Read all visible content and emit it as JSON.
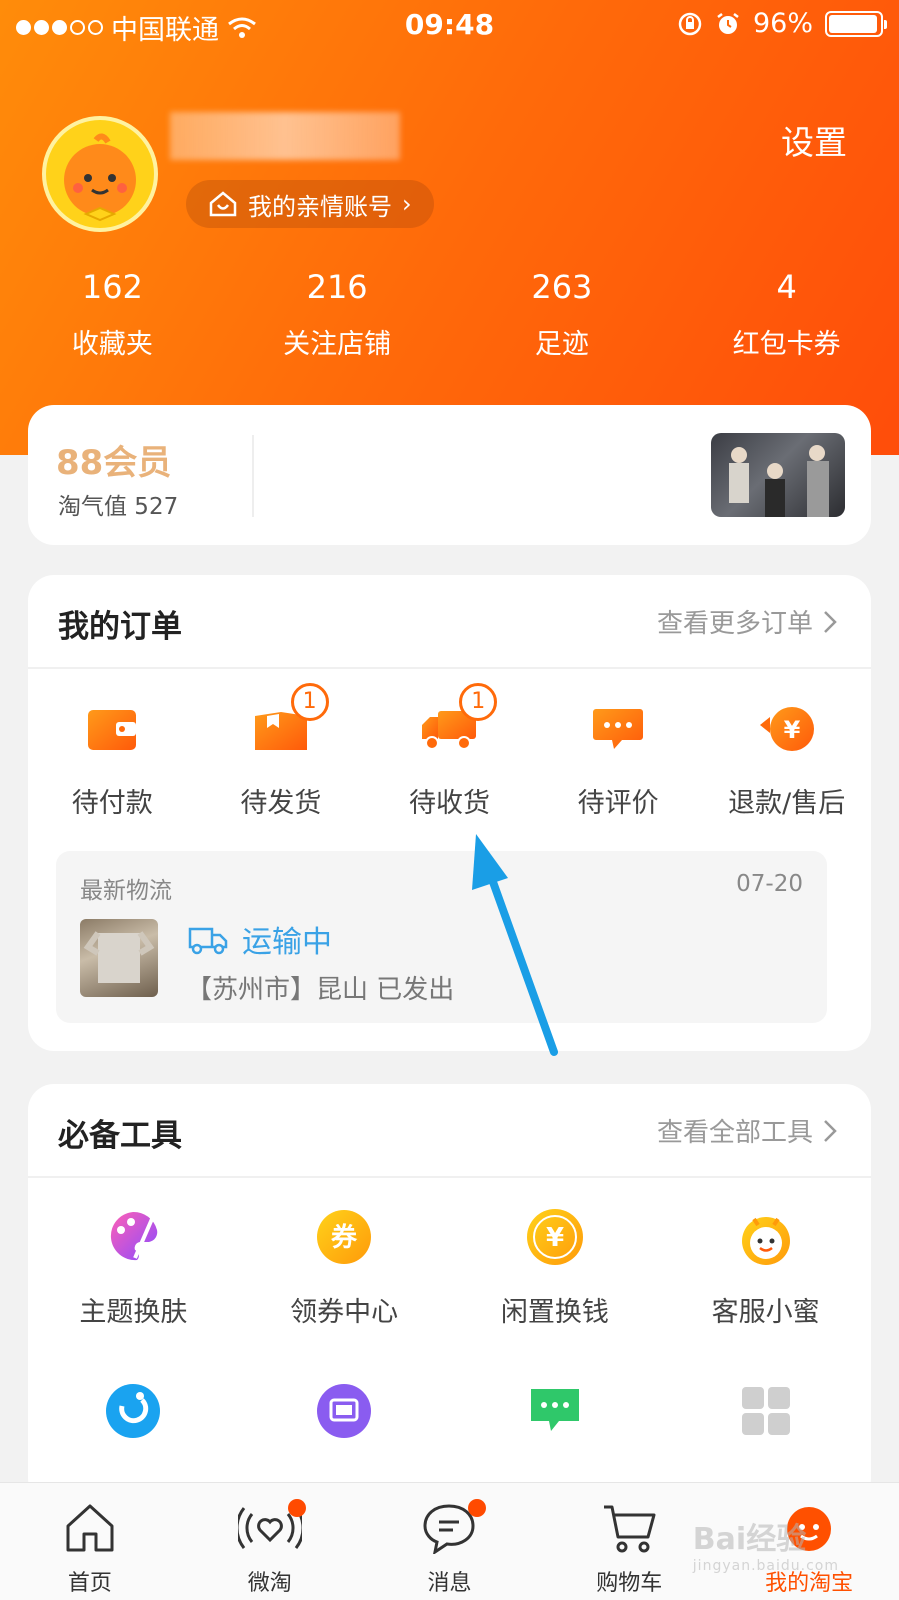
{
  "status_bar": {
    "carrier": "中国联通",
    "time": "09:48",
    "battery": "96%",
    "battery_level": 0.96
  },
  "profile": {
    "family_account": "我的亲情账号",
    "settings": "设置"
  },
  "stats": [
    {
      "count": "162",
      "label": "收藏夹"
    },
    {
      "count": "216",
      "label": "关注店铺"
    },
    {
      "count": "263",
      "label": "足迹"
    },
    {
      "count": "4",
      "label": "红包卡券"
    }
  ],
  "vip": {
    "title": "88会员",
    "score": "淘气值 527"
  },
  "orders": {
    "title": "我的订单",
    "more": "查看更多订单",
    "items": [
      {
        "label": "待付款",
        "icon": "wallet-icon",
        "badge": ""
      },
      {
        "label": "待发货",
        "icon": "package-icon",
        "badge": "1"
      },
      {
        "label": "待收货",
        "icon": "truck-icon",
        "badge": "1"
      },
      {
        "label": "待评价",
        "icon": "comment-icon",
        "badge": ""
      },
      {
        "label": "退款/售后",
        "icon": "refund-icon",
        "badge": ""
      }
    ],
    "logistics": {
      "title": "最新物流",
      "date": "07-20",
      "status": "运输中",
      "detail": "【苏州市】昆山 已发出"
    }
  },
  "tools": {
    "title": "必备工具",
    "more": "查看全部工具",
    "items": [
      {
        "label": "主题换肤",
        "icon": "palette-icon"
      },
      {
        "label": "领券中心",
        "icon": "coupon-icon"
      },
      {
        "label": "闲置换钱",
        "icon": "yuan-coin-icon"
      },
      {
        "label": "客服小蜜",
        "icon": "assistant-icon"
      },
      {
        "label": "",
        "icon": "alipay-icon"
      },
      {
        "label": "",
        "icon": "screen-icon"
      },
      {
        "label": "",
        "icon": "chat-bubble-icon"
      },
      {
        "label": "",
        "icon": "grid-icon"
      }
    ]
  },
  "tabs": [
    {
      "label": "首页",
      "icon": "home-icon"
    },
    {
      "label": "微淘",
      "icon": "weitao-icon"
    },
    {
      "label": "消息",
      "icon": "message-icon"
    },
    {
      "label": "购物车",
      "icon": "cart-icon"
    },
    {
      "label": "我的淘宝",
      "icon": "my-taobao-icon"
    }
  ],
  "watermark": {
    "brand": "Bai经验",
    "site": "jingyan.baidu.com"
  },
  "colors": {
    "brand_orange": "#ff5000",
    "badge": "#ff6a0a",
    "logistics_blue": "#3aa2e6",
    "annotation_arrow": "#1a9ee6"
  }
}
